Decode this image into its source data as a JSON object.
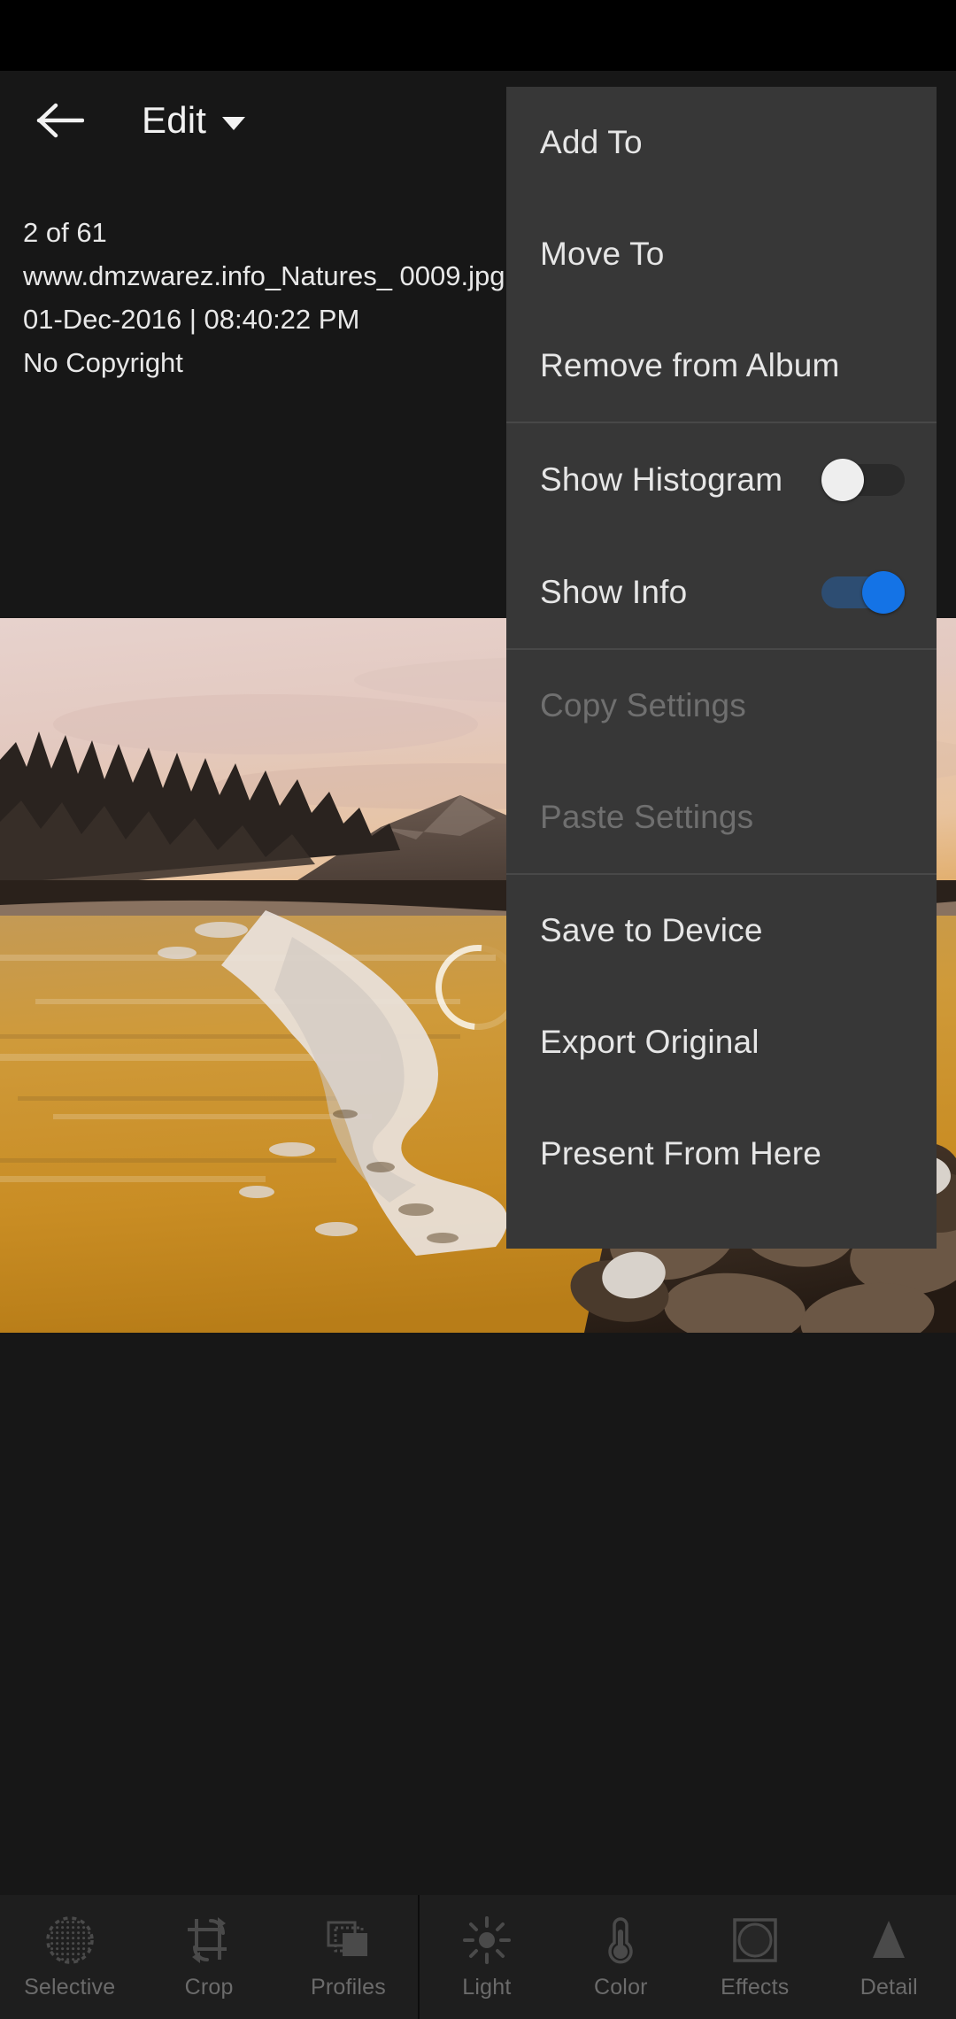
{
  "app": {
    "background_color": "#171717",
    "accent_color": "#1473e6"
  },
  "header": {
    "back_icon": "arrow-left-icon",
    "title": "Edit",
    "caret_icon": "chevron-down-icon"
  },
  "info_panel": {
    "counter": "2 of 61",
    "filename": "www.dmzwarez.info_Natures_ 0009.jpg",
    "datetime": "01-Dec-2016 | 08:40:22 PM",
    "copyright": "No Copyright"
  },
  "photo": {
    "loading_indicator": "spinner-icon"
  },
  "menu": {
    "background_color": "#373737",
    "groups": [
      {
        "items": [
          {
            "label": "Add To",
            "type": "action",
            "enabled": true
          },
          {
            "label": "Move To",
            "type": "action",
            "enabled": true
          },
          {
            "label": "Remove from Album",
            "type": "action",
            "enabled": true
          }
        ]
      },
      {
        "items": [
          {
            "label": "Show Histogram",
            "type": "toggle",
            "enabled": true,
            "value": false
          },
          {
            "label": "Show Info",
            "type": "toggle",
            "enabled": true,
            "value": true
          }
        ]
      },
      {
        "items": [
          {
            "label": "Copy Settings",
            "type": "action",
            "enabled": false
          },
          {
            "label": "Paste Settings",
            "type": "action",
            "enabled": false
          }
        ]
      },
      {
        "items": [
          {
            "label": "Save to Device",
            "type": "action",
            "enabled": true
          },
          {
            "label": "Export Original",
            "type": "action",
            "enabled": true
          },
          {
            "label": "Present From Here",
            "type": "action",
            "enabled": true
          }
        ]
      }
    ]
  },
  "toolbar": {
    "left_items": [
      {
        "label": "Selective",
        "icon": "selective-dots-circle-icon"
      },
      {
        "label": "Crop",
        "icon": "crop-rotate-icon"
      },
      {
        "label": "Profiles",
        "icon": "profiles-stack-icon"
      }
    ],
    "right_items": [
      {
        "label": "Light",
        "icon": "sun-icon"
      },
      {
        "label": "Color",
        "icon": "thermometer-icon"
      },
      {
        "label": "Effects",
        "icon": "effects-square-circle-icon"
      },
      {
        "label": "Detail",
        "icon": "triangle-icon"
      }
    ]
  }
}
